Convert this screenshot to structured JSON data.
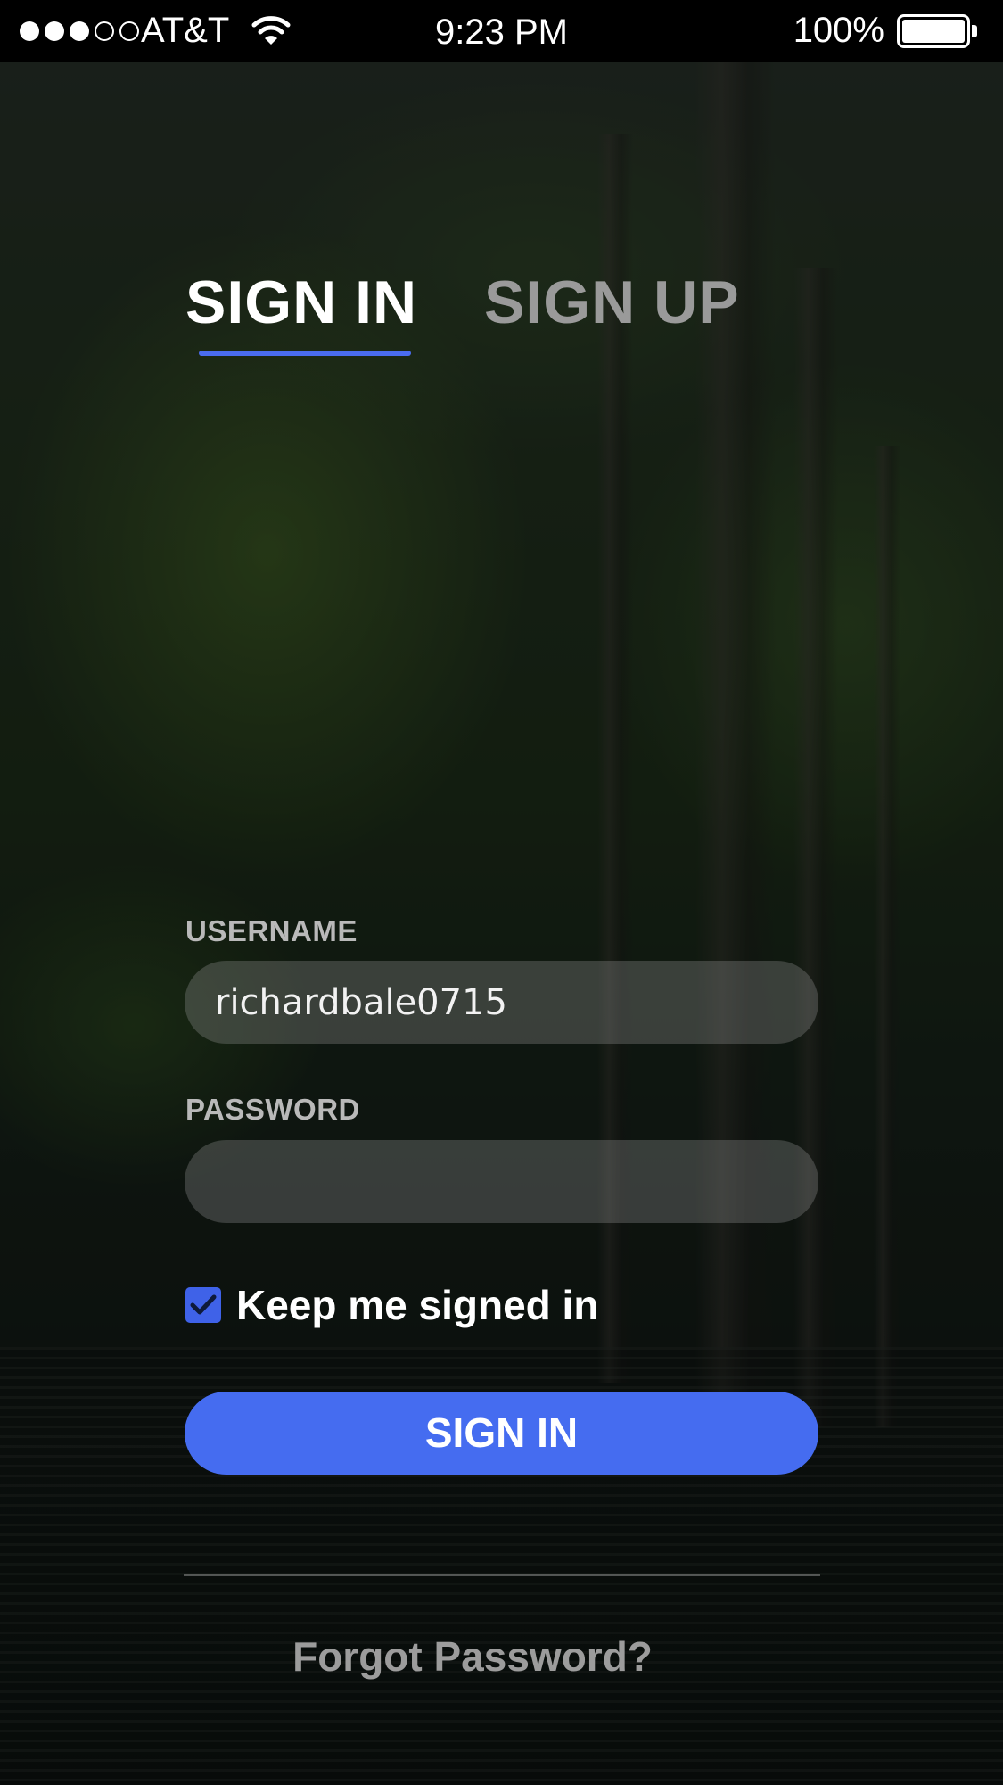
{
  "status_bar": {
    "signal_dots": [
      true,
      true,
      true,
      false,
      false
    ],
    "carrier": "AT&T",
    "time": "9:23 PM",
    "battery_percent": "100%",
    "battery_level": 1.0,
    "icons": [
      "wifi-icon",
      "battery-icon"
    ]
  },
  "tabs": {
    "sign_in": "SIGN IN",
    "sign_up": "SIGN UP",
    "active": "sign_in"
  },
  "form": {
    "username_label": "USERNAME",
    "username_value": "richardbale0715",
    "password_label": "PASSWORD",
    "password_value": "",
    "keep_signed_in_label": "Keep me signed in",
    "keep_signed_in_checked": true,
    "submit_label": "SIGN IN",
    "forgot_password": "Forgot Password?"
  },
  "colors": {
    "accent": "#456cf0",
    "status_bar_bg": "#000000",
    "inactive_tab": "#9a9a9a",
    "label": "#b9b9b9"
  }
}
